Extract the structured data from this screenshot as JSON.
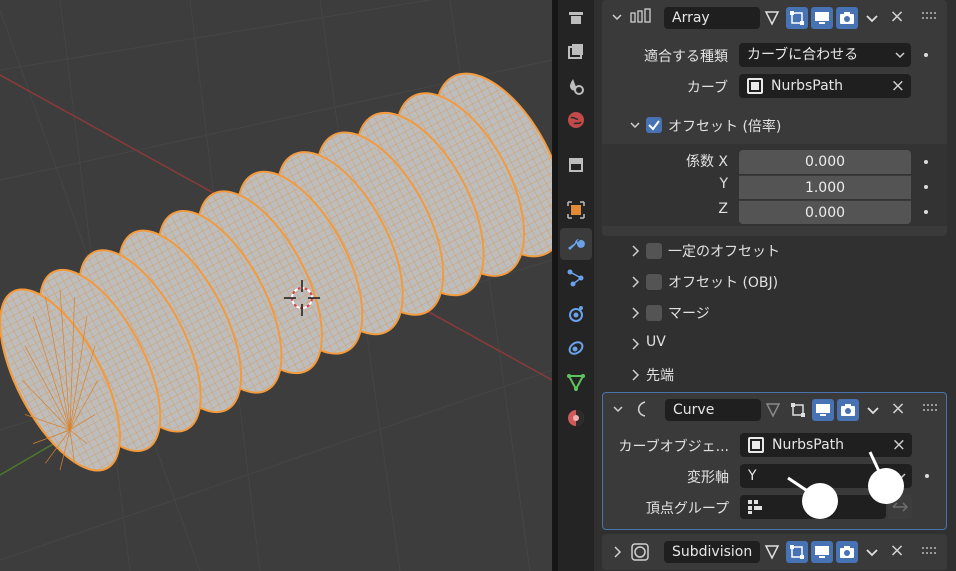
{
  "viewport": {
    "label": "3D viewport"
  },
  "tabs": [
    {
      "name": "render-tab",
      "icon": "render-icon"
    },
    {
      "name": "output-tab",
      "icon": "output-icon"
    },
    {
      "name": "view-layer-tab",
      "icon": "view-layer-icon"
    },
    {
      "name": "world-tab",
      "icon": "world-icon"
    },
    {
      "name": "collection-tab",
      "icon": "collection-icon"
    },
    {
      "name": "object-tab",
      "icon": "object-icon"
    },
    {
      "name": "modifier-tab",
      "icon": "wrench-icon"
    },
    {
      "name": "particles-tab",
      "icon": "particles-icon"
    },
    {
      "name": "physics-tab",
      "icon": "physics-icon"
    },
    {
      "name": "constraints-tab",
      "icon": "constraints-icon"
    },
    {
      "name": "data-tab",
      "icon": "mesh-data-icon"
    },
    {
      "name": "material-tab",
      "icon": "material-icon"
    }
  ],
  "array": {
    "name": "Array",
    "fit_type_label": "適合する種類",
    "fit_type_value": "カーブに合わせる",
    "curve_label": "カーブ",
    "curve_value": "NurbsPath",
    "offset_label": "オフセット (倍率)",
    "factor_label": "係数 X",
    "y_label": "Y",
    "z_label": "Z",
    "x_value": "0.000",
    "y_value": "1.000",
    "z_value": "0.000",
    "subsections": [
      {
        "label": "一定のオフセット",
        "checkbox": true
      },
      {
        "label": "オフセット (OBJ)",
        "checkbox": true
      },
      {
        "label": "マージ",
        "checkbox": true
      },
      {
        "label": "UV",
        "checkbox": false
      },
      {
        "label": "先端",
        "checkbox": false
      }
    ]
  },
  "curve": {
    "name": "Curve",
    "object_label": "カーブオブジェ...",
    "object_value": "NurbsPath",
    "axis_label": "変形軸",
    "axis_value": "Y",
    "vgroup_label": "頂点グループ"
  },
  "subdivision": {
    "name": "Subdivision"
  },
  "colors": {
    "accent": "#4772b3",
    "mesh_wire": "#f29a3c",
    "viewport_bg": "#3d3d3d"
  }
}
